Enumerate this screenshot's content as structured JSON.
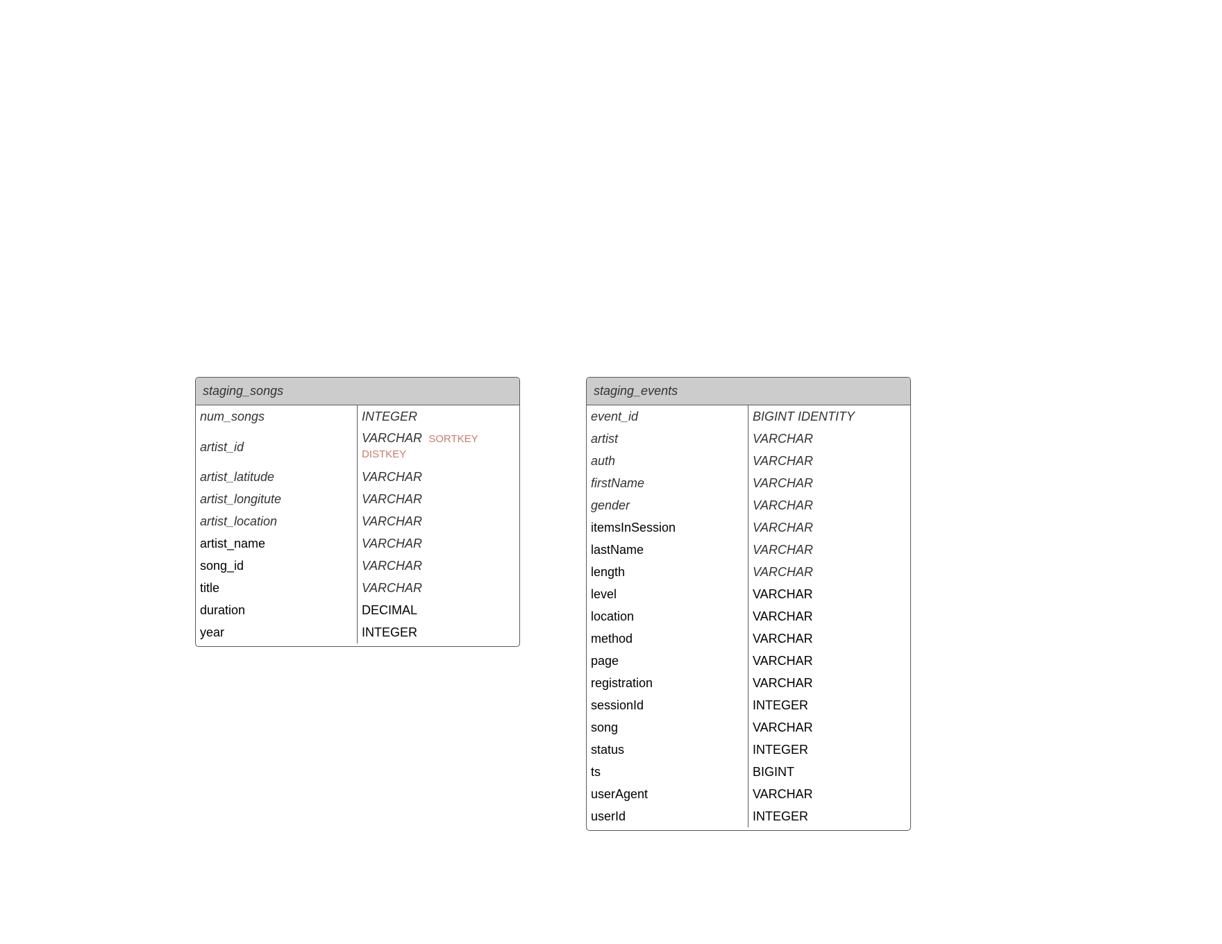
{
  "diagram": {
    "tables": [
      {
        "name": "staging_songs",
        "columns": [
          {
            "name": "num_songs",
            "type": "INTEGER",
            "keys": "",
            "italic": true
          },
          {
            "name": "artist_id",
            "type": "VARCHAR",
            "keys": "SORTKEY DISTKEY",
            "italic": true
          },
          {
            "name": "artist_latitude",
            "type": "VARCHAR",
            "keys": "",
            "italic": true
          },
          {
            "name": "artist_longitute",
            "type": "VARCHAR",
            "keys": "",
            "italic": true
          },
          {
            "name": "artist_location",
            "type": "VARCHAR",
            "keys": "",
            "italic": true
          },
          {
            "name": "artist_name",
            "type": "VARCHAR",
            "keys": "",
            "italic": false,
            "type_italic": true
          },
          {
            "name": "song_id",
            "type": "VARCHAR",
            "keys": "",
            "italic": false,
            "type_italic": true
          },
          {
            "name": "title",
            "type": "VARCHAR",
            "keys": "",
            "italic": false,
            "type_italic": true
          },
          {
            "name": "duration",
            "type": "DECIMAL",
            "keys": "",
            "italic": false,
            "type_italic": false
          },
          {
            "name": "year",
            "type": "INTEGER",
            "keys": "",
            "italic": false,
            "type_italic": false
          }
        ]
      },
      {
        "name": "staging_events",
        "columns": [
          {
            "name": "event_id",
            "type": "BIGINT IDENTITY",
            "italic": true
          },
          {
            "name": "artist",
            "type": "VARCHAR",
            "italic": true
          },
          {
            "name": "auth",
            "type": "VARCHAR",
            "italic": true
          },
          {
            "name": "firstName",
            "type": "VARCHAR",
            "italic": true
          },
          {
            "name": "gender",
            "type": "VARCHAR",
            "italic": true
          },
          {
            "name": "itemsInSession",
            "type": "VARCHAR",
            "italic": false,
            "type_italic": true
          },
          {
            "name": "lastName",
            "type": "VARCHAR",
            "italic": false,
            "type_italic": true
          },
          {
            "name": "length",
            "type": "VARCHAR",
            "italic": false,
            "type_italic": true
          },
          {
            "name": "level",
            "type": "VARCHAR",
            "italic": false,
            "type_italic": false
          },
          {
            "name": "location",
            "type": "VARCHAR",
            "italic": false,
            "type_italic": false
          },
          {
            "name": "method",
            "type": "VARCHAR",
            "italic": false,
            "type_italic": false
          },
          {
            "name": "page",
            "type": "VARCHAR",
            "italic": false,
            "type_italic": false
          },
          {
            "name": "registration",
            "type": "VARCHAR",
            "italic": false,
            "type_italic": false
          },
          {
            "name": "sessionId",
            "type": "INTEGER",
            "italic": false,
            "type_italic": false
          },
          {
            "name": "song",
            "type": "VARCHAR",
            "italic": false,
            "type_italic": false
          },
          {
            "name": "status",
            "type": "INTEGER",
            "italic": false,
            "type_italic": false
          },
          {
            "name": "ts",
            "type": "BIGINT",
            "italic": false,
            "type_italic": false
          },
          {
            "name": "userAgent",
            "type": "VARCHAR",
            "italic": false,
            "type_italic": false
          },
          {
            "name": "userId",
            "type": "INTEGER",
            "italic": false,
            "type_italic": false
          }
        ]
      }
    ]
  },
  "colors": {
    "header_bg": "#cccccc",
    "border": "#595959",
    "key_text": "#c97c6a"
  }
}
